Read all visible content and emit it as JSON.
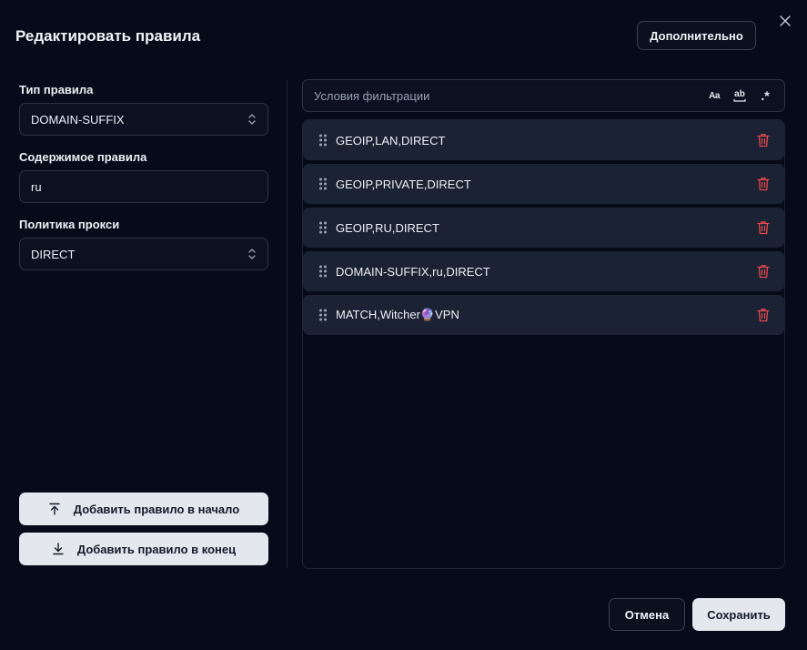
{
  "dialog": {
    "title": "Редактировать правила",
    "advanced_label": "Дополнительно",
    "close_icon": "close-icon"
  },
  "form": {
    "rule_type": {
      "label": "Тип правила",
      "value": "DOMAIN-SUFFIX"
    },
    "rule_content": {
      "label": "Содержимое правила",
      "value": "ru"
    },
    "proxy_policy": {
      "label": "Политика прокси",
      "value": "DIRECT"
    }
  },
  "actions": {
    "add_to_start": "Добавить правило в начало",
    "add_to_end": "Добавить правило в конец"
  },
  "filter": {
    "placeholder": "Условия фильтрации",
    "match_case_glyph": "Aa",
    "whole_word_glyph": "ab",
    "regex_glyph": ".*"
  },
  "rules": [
    {
      "text": "GEOIP,LAN,DIRECT"
    },
    {
      "text": "GEOIP,PRIVATE,DIRECT"
    },
    {
      "text": "GEOIP,RU,DIRECT"
    },
    {
      "text": "DOMAIN-SUFFIX,ru,DIRECT"
    },
    {
      "text": "MATCH,Witcher🔮VPN"
    }
  ],
  "footer": {
    "cancel_label": "Отмена",
    "save_label": "Сохранить"
  },
  "colors": {
    "background": "#070a19",
    "row_bg": "#1a2233",
    "danger": "#e5484d",
    "primary_button": "#e4e7ee"
  }
}
